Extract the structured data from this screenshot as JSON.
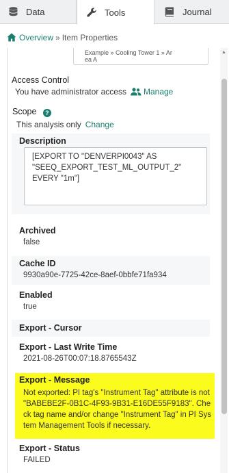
{
  "tabs": [
    {
      "label": "Data",
      "icon": "database-icon"
    },
    {
      "label": "Tools",
      "icon": "wrench-icon"
    },
    {
      "label": "Journal",
      "icon": "book-icon"
    }
  ],
  "breadcrumb": {
    "home_link": "Overview",
    "separator": "»",
    "current": "Item Properties"
  },
  "asset_path": {
    "line1": "Example » Cooling Tower 1 » Ar",
    "line2": "ea A"
  },
  "access_control": {
    "label": "Access Control",
    "text": "You have administrator access",
    "manage_label": "Manage"
  },
  "scope": {
    "label": "Scope",
    "text": "This analysis only",
    "change_label": "Change"
  },
  "description": {
    "label": "Description",
    "value": "[EXPORT TO \"DENVERPI0043\" AS \"SEEQ_EXPORT_TEST_ML_OUTPUT_2\" EVERY \"1m\"]"
  },
  "properties": [
    {
      "label": "Archived",
      "value": "false"
    },
    {
      "label": "Cache ID",
      "value": "9930a90e-7725-42ce-8aef-0bbfe71fa934"
    },
    {
      "label": "Enabled",
      "value": "true"
    },
    {
      "label": "Export - Cursor",
      "value": ""
    },
    {
      "label": "Export - Last Write Time",
      "value": "2021-08-26T00:07:18.8765543Z"
    },
    {
      "label": "Export - Message",
      "value": "Not exported: PI tag's \"Instrument Tag\" attribute is not \"BABEBE2F-0B1C-4F93-9B31-E16DE55F9183\". Check tag name and/or change \"Instrument Tag\" in PI System Management Tools if necessary."
    },
    {
      "label": "Export - Status",
      "value": "FAILED"
    }
  ],
  "colors": {
    "accent": "#1a7f6d",
    "highlight": "#fbfb1e",
    "row_alt": "#f6f7f8"
  }
}
